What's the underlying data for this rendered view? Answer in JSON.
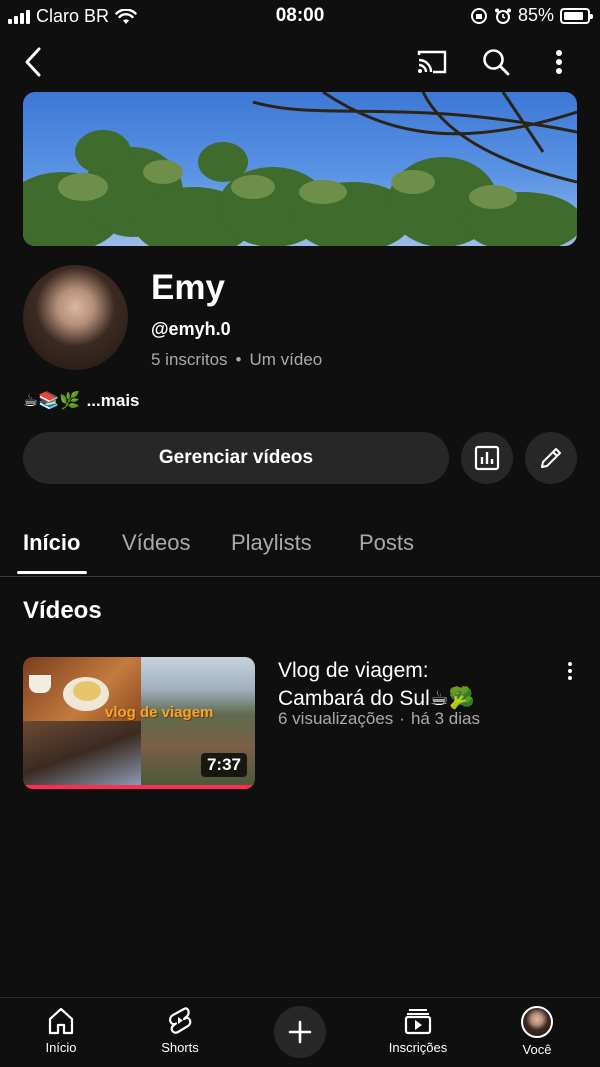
{
  "status_bar": {
    "carrier": "Claro BR",
    "time": "08:00",
    "battery": "85%",
    "battery_level": 0.85
  },
  "top_nav": {
    "icons": [
      "back-icon",
      "cast-icon",
      "search-icon",
      "more-vert-icon"
    ]
  },
  "channel": {
    "name": "Emy",
    "handle": "@emyh.0",
    "subscribers": "5 inscritos",
    "separator": "•",
    "video_count": "Um vídeo",
    "bio_emojis": "☕📚🌿",
    "bio_more": "...mais"
  },
  "actions": {
    "manage_label": "Gerenciar vídeos",
    "analytics_icon": "analytics-icon",
    "edit_icon": "pencil-icon"
  },
  "tabs": [
    {
      "label": "Início",
      "active": true
    },
    {
      "label": "Vídeos",
      "active": false
    },
    {
      "label": "Playlists",
      "active": false
    },
    {
      "label": "Posts",
      "active": false
    }
  ],
  "section": {
    "title": "Vídeos"
  },
  "videos": [
    {
      "title": "Vlog de viagem: Cambará do Sul☕🥦",
      "views": "6 visualizações",
      "separator": "·",
      "age": "há 3 dias",
      "duration": "7:37",
      "thumbnail_text": "vlog de viagem",
      "watched_fraction": 1.0
    }
  ],
  "bottom_nav": [
    {
      "label": "Início",
      "icon": "home-icon"
    },
    {
      "label": "Shorts",
      "icon": "shorts-icon"
    },
    {
      "label": "",
      "icon": "plus-icon"
    },
    {
      "label": "Inscrições",
      "icon": "subscriptions-icon"
    },
    {
      "label": "Você",
      "icon": "avatar-icon"
    }
  ]
}
